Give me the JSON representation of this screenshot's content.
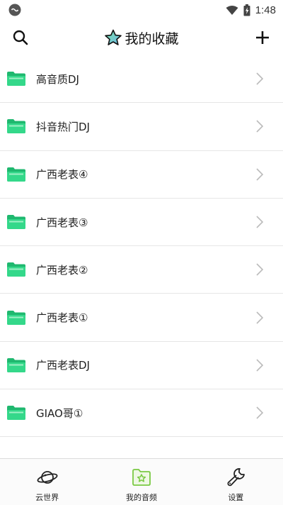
{
  "status": {
    "time": "1:48"
  },
  "header": {
    "title": "我的收藏"
  },
  "list": {
    "items": [
      {
        "label": "高音质DJ"
      },
      {
        "label": "抖音热门DJ"
      },
      {
        "label": "广西老表④"
      },
      {
        "label": "广西老表③"
      },
      {
        "label": "广西老表②"
      },
      {
        "label": "广西老表①"
      },
      {
        "label": "广西老表DJ"
      },
      {
        "label": "GIAO哥①"
      }
    ]
  },
  "bottom_nav": {
    "items": [
      {
        "label": "云世界",
        "icon": "planet-icon"
      },
      {
        "label": "我的音频",
        "icon": "star-folder-icon",
        "active": true
      },
      {
        "label": "设置",
        "icon": "wrench-icon"
      }
    ]
  },
  "colors": {
    "folder": "#34d88a",
    "folder_dark": "#1fb86f",
    "active_nav": "#7ac943"
  }
}
